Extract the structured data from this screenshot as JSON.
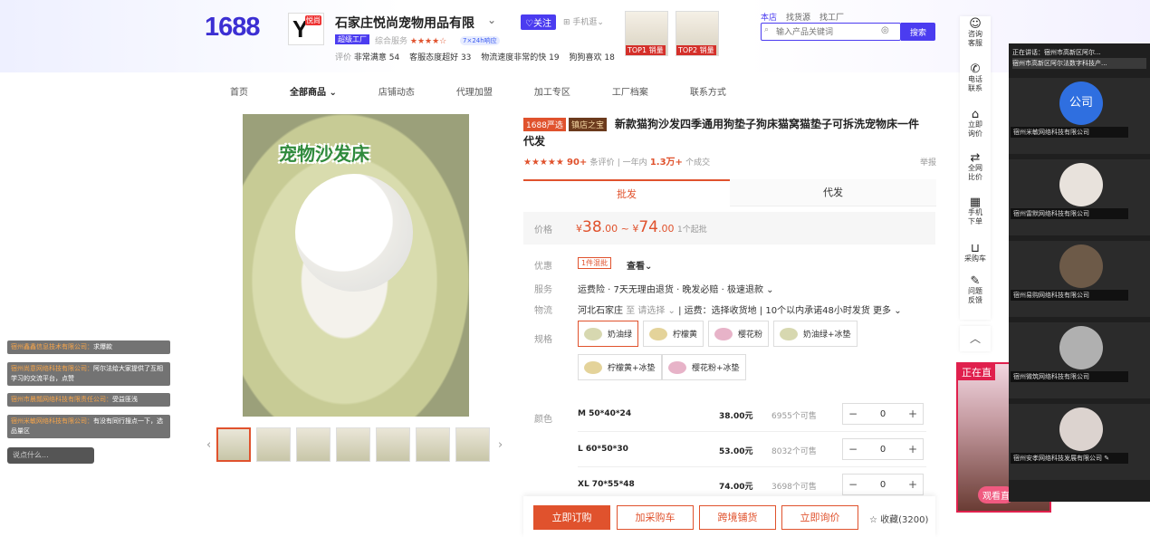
{
  "header": {
    "logo": "1688",
    "shop_name": "石家庄悦尚宠物用品有限",
    "shop_name_caret": "⌄",
    "shop_logo_mark": "Y",
    "shop_logo_badge": "悦尚",
    "follow_label": "♡关注",
    "mobile_label": "⊞ 手机逛⌄",
    "tag_label": "超级工厂",
    "service_label": "综合服务",
    "service_stars": "★★★★☆",
    "badge_label": "7×24h响应",
    "ratings": [
      {
        "label": "评价",
        "value": ""
      },
      {
        "label": "",
        "value": "非常满意 54"
      },
      {
        "label": "客服态度超好 33",
        "value": ""
      },
      {
        "label": "物流速度非常的快 19",
        "value": ""
      },
      {
        "label": "狗狗喜欢 18",
        "value": ""
      }
    ],
    "top_badges": [
      "TOP1 销量",
      "TOP2 销量"
    ]
  },
  "search": {
    "tabs": [
      "本店",
      "找货源",
      "找工厂"
    ],
    "placeholder": "输入产品关键词",
    "button": "搜索"
  },
  "nav": [
    "首页",
    "全部商品 ⌄",
    "店铺动态",
    "代理加盟",
    "加工专区",
    "工厂档案",
    "联系方式"
  ],
  "product": {
    "image_title": "宠物沙发床",
    "tag_a": "1688严选",
    "tag_b": "镇店之宝",
    "title": "新款猫狗沙发四季通用狗垫子狗床猫窝猫垫子可拆洗宠物床一件代发",
    "stars": "★★★★★",
    "review_count": "90+",
    "review_label": "条评价",
    "sales_prefix": "一年内",
    "sales": "1.3万+",
    "sales_suffix": "个成交",
    "report": "举报"
  },
  "tabs": [
    "批发",
    "代发"
  ],
  "price": {
    "label": "价格",
    "currency": "¥",
    "min_int": "38",
    "min_dec": ".00",
    "sep": "~",
    "max_int": "74",
    "max_dec": ".00",
    "moq": "1个起批"
  },
  "offers": {
    "label": "优惠",
    "coupon": "1件混批",
    "view": "查看⌄"
  },
  "service": {
    "label": "服务",
    "text": "运费险 · 7天无理由退货 · 晚发必赔 · 极速退款 ⌄"
  },
  "logistics": {
    "label": "物流",
    "origin": "河北石家庄",
    "to": "至 请选择 ⌄",
    "fee": "运费：选择收货地",
    "promise": "10个以内承诺48小时发货",
    "more": "更多 ⌄"
  },
  "spec": {
    "label": "规格",
    "options": [
      "奶油绿",
      "柠檬黄",
      "樱花粉",
      "奶油绿+冰垫",
      "柠檬黄+冰垫",
      "樱花粉+冰垫"
    ]
  },
  "color": {
    "label": "颜色",
    "rows": [
      {
        "size": "M 50*40*24",
        "price": "38.00元",
        "stock": "6955个可售",
        "qty": "0"
      },
      {
        "size": "L 60*50*30",
        "price": "53.00元",
        "stock": "8032个可售",
        "qty": "0"
      },
      {
        "size": "XL 70*55*48",
        "price": "74.00元",
        "stock": "3698个可售",
        "qty": "0"
      }
    ]
  },
  "actions": {
    "order": "立即订购",
    "cart": "加采购车",
    "cross": "跨境铺货",
    "inquiry": "立即询价",
    "favorite": "☆ 收藏(3200)"
  },
  "sidebar": [
    {
      "icon": "☺",
      "label": "咨询\n客服"
    },
    {
      "icon": "✆",
      "label": "电话\n联系"
    },
    {
      "icon": "⌂",
      "label": "立即\n询价"
    },
    {
      "icon": "⇄",
      "label": "全网\n比价"
    },
    {
      "icon": "▦",
      "label": "手机\n下单"
    },
    {
      "icon": "⊔",
      "label": "采购车"
    },
    {
      "icon": "✎",
      "label": "问题\n反馈"
    }
  ],
  "up_icon": "︿",
  "live": {
    "header": "正在直",
    "watch": "观看直"
  },
  "call": {
    "speaking": "正在讲话：宿州市高新区阿尔...",
    "caption": "宿州市高新区阿尔法数字科技产...",
    "participants": [
      {
        "name": "宿州米敏网络科技有限公司",
        "avatar": "公司"
      },
      {
        "name": "宿州雷默网络科技有限公司",
        "avatar": ""
      },
      {
        "name": "宿州易购网络科技有限公司",
        "avatar": ""
      },
      {
        "name": "宿州微筑网络科技有限公司",
        "avatar": ""
      },
      {
        "name": "宿州安孝网络科技发展有限公司 ✎",
        "avatar": ""
      }
    ]
  },
  "chat": [
    {
      "user": "宿州鑫鑫信息技术有限公司：",
      "msg": "求爆款"
    },
    {
      "user": "宿州尚意网络科技有限公司：",
      "msg": "阿尔法给大家提供了互相学习的交流平台，点赞"
    },
    {
      "user": "宿州市晨瓢网络科技有限责任公司：",
      "msg": "受益匪浅"
    },
    {
      "user": "宿州米敏网络科技有限公司：",
      "msg": "有没有同行搜点一下，选品量区"
    }
  ],
  "chat_input": "说点什么...",
  "colors": {
    "accent": "#e0522d",
    "brand": "#4b3cf0"
  }
}
